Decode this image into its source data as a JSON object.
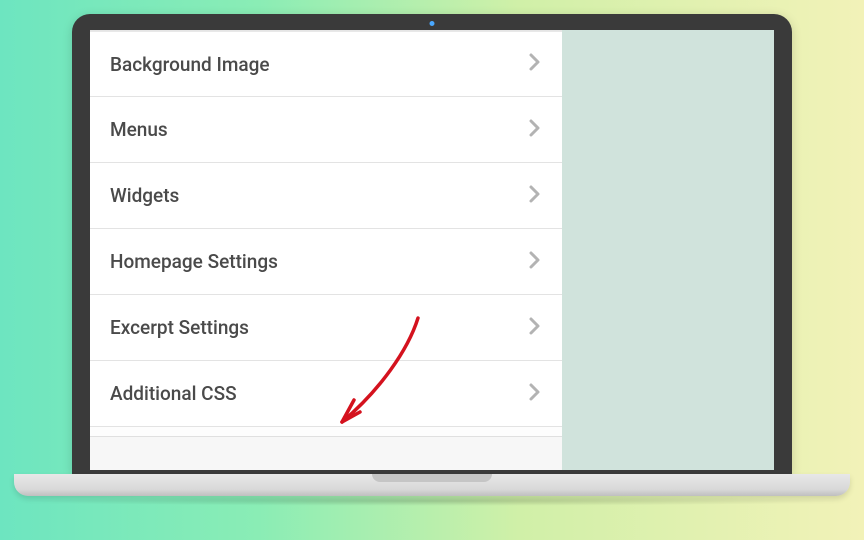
{
  "customizer": {
    "menu": [
      {
        "label": "Background Image"
      },
      {
        "label": "Menus"
      },
      {
        "label": "Widgets"
      },
      {
        "label": "Homepage Settings"
      },
      {
        "label": "Excerpt Settings"
      },
      {
        "label": "Additional CSS"
      }
    ]
  },
  "annotation": {
    "target": "Additional CSS"
  }
}
